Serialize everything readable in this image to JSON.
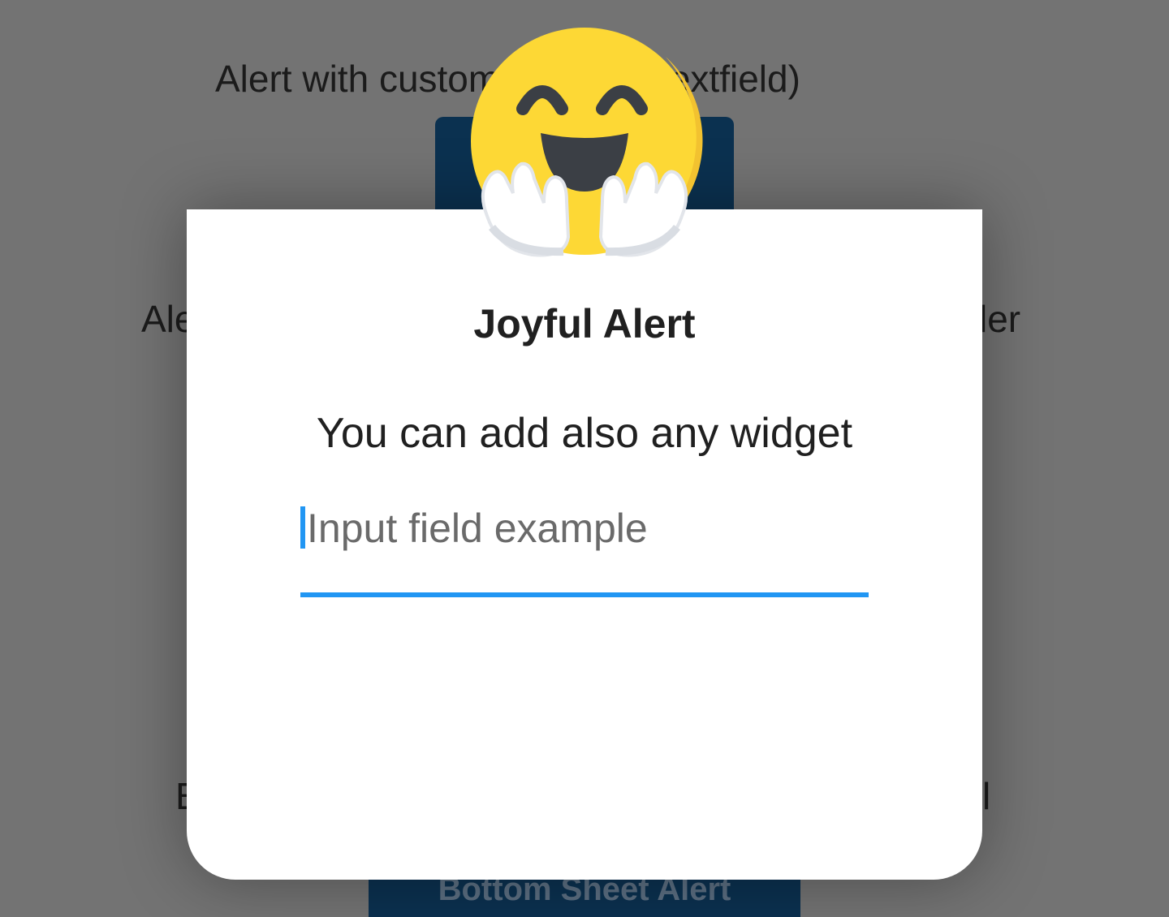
{
  "background": {
    "label_custom_widgets": "Alert with custom widgets (textfield)",
    "label_second_left": "Ale",
    "label_second_right": "ler",
    "label_third_left": "B",
    "label_third_right": "l",
    "bottom_sheet_button": "Bottom Sheet Alert"
  },
  "dialog": {
    "title": "Joyful Alert",
    "message": "You can add also any widget",
    "input": {
      "value": "",
      "placeholder": "Input field example"
    },
    "icon": "hugging-face-emoji-icon"
  },
  "colors": {
    "accent": "#2196f3",
    "button": "#0b3150",
    "overlay": "#737373",
    "emoji_face": "#fdd835"
  }
}
